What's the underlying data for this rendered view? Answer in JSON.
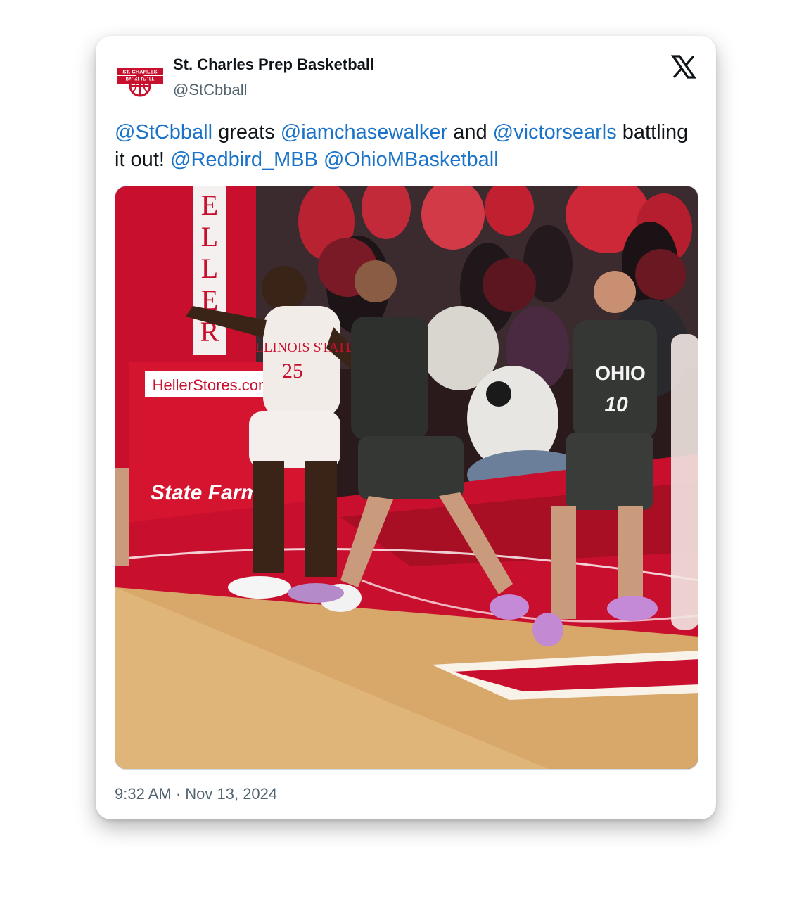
{
  "author": {
    "display_name": "St. Charles Prep Basketball",
    "handle": "@StCbball",
    "avatar_text_top": "ST. CHARLES",
    "avatar_text_bottom": "BASKETBALL"
  },
  "tweet": {
    "segments": [
      {
        "text": "@StCbball",
        "type": "mention"
      },
      {
        "text": " greats ",
        "type": "text"
      },
      {
        "text": "@iamchasewalker",
        "type": "mention"
      },
      {
        "text": " and ",
        "type": "text"
      },
      {
        "text": "@victorsearls",
        "type": "mention"
      },
      {
        "text": " battling it out! ",
        "type": "text"
      },
      {
        "text": "@Redbird_MBB",
        "type": "mention"
      },
      {
        "text": " ",
        "type": "text"
      },
      {
        "text": "@OhioMBasketball",
        "type": "mention"
      }
    ]
  },
  "media": {
    "signage_banner": "HellerStores.com",
    "signage_sponsor": "State Farm",
    "pillar_letters": "ELLER",
    "jersey_left_text": "ILLINOIS STATE",
    "jersey_left_number": "25",
    "jersey_right_text": "OHIO",
    "jersey_right_number": "10"
  },
  "timestamp": "9:32 AM · Nov 13, 2024",
  "icons": {
    "platform": "x-logo-icon",
    "avatar": "basketball-logo-icon"
  },
  "colors": {
    "mention": "#1a73c9",
    "text": "#0f1419",
    "secondary": "#536471",
    "court_red": "#c8102e"
  }
}
